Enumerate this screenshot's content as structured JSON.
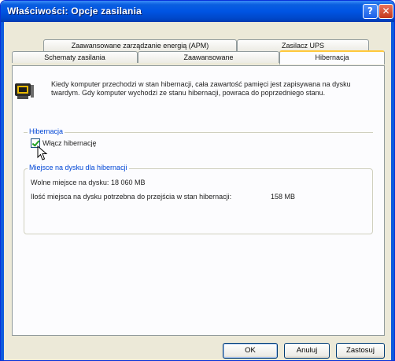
{
  "window": {
    "title": "Właściwości: Opcje zasilania",
    "help_label": "?",
    "close_label": "✕"
  },
  "tabs": {
    "row1": [
      "Zaawansowane zarządzanie energią (APM)",
      "Zasilacz UPS"
    ],
    "row2": [
      "Schematy zasilania",
      "Zaawansowane",
      "Hibernacja"
    ],
    "active": "Hibernacja"
  },
  "hibernation": {
    "description": "Kiedy komputer przechodzi w stan hibernacji, cała zawartość pamięci jest zapisywana na dysku twardym. Gdy komputer wychodzi ze stanu hibernacji, powraca do poprzedniego stanu.",
    "group_title": "Hibernacja",
    "checkbox_label": "Włącz hibernację",
    "checkbox_checked": true
  },
  "disk": {
    "group_title": "Miejsce na dysku dla hibernacji",
    "free_label": "Wolne miejsce na dysku:",
    "free_value": "18 060 MB",
    "required_label": "Ilość miejsca na dysku potrzebna do przejścia w stan hibernacji:",
    "required_value": "158 MB"
  },
  "buttons": {
    "ok": "OK",
    "cancel": "Anuluj",
    "apply": "Zastosuj"
  },
  "colors": {
    "title_bar": "#0054e3",
    "accent_tab": "#ffc83c",
    "group_title": "#0046d5",
    "close_button": "#c4381c"
  }
}
